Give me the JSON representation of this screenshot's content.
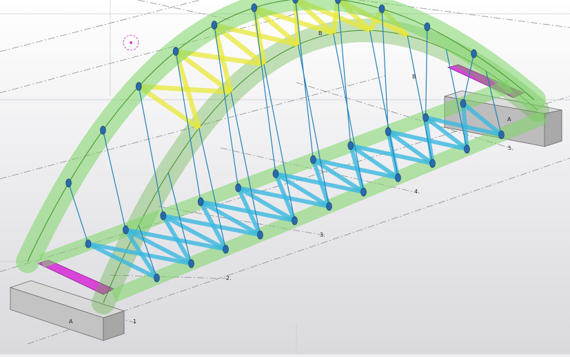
{
  "grid_labels": {
    "a_left": "A",
    "a_right": "A",
    "b_top": "B",
    "b_mid": "B",
    "n1": "1",
    "n2": "2.",
    "n3": "3.",
    "n4": "4.",
    "n5": "5."
  },
  "colors": {
    "background": "#eeeef0",
    "arch_fill": "#8fe07a",
    "arch_stroke": "#4aa030",
    "deck_fill": "#8fe07a",
    "upper_bracing": "#f0f050",
    "lower_bracing": "#3ab8e0",
    "hanger": "#2090c0",
    "end_beam": "#d040d0",
    "abutment": "#c8c8c8",
    "grid": "#777777",
    "connection": "#2a5a9a"
  }
}
